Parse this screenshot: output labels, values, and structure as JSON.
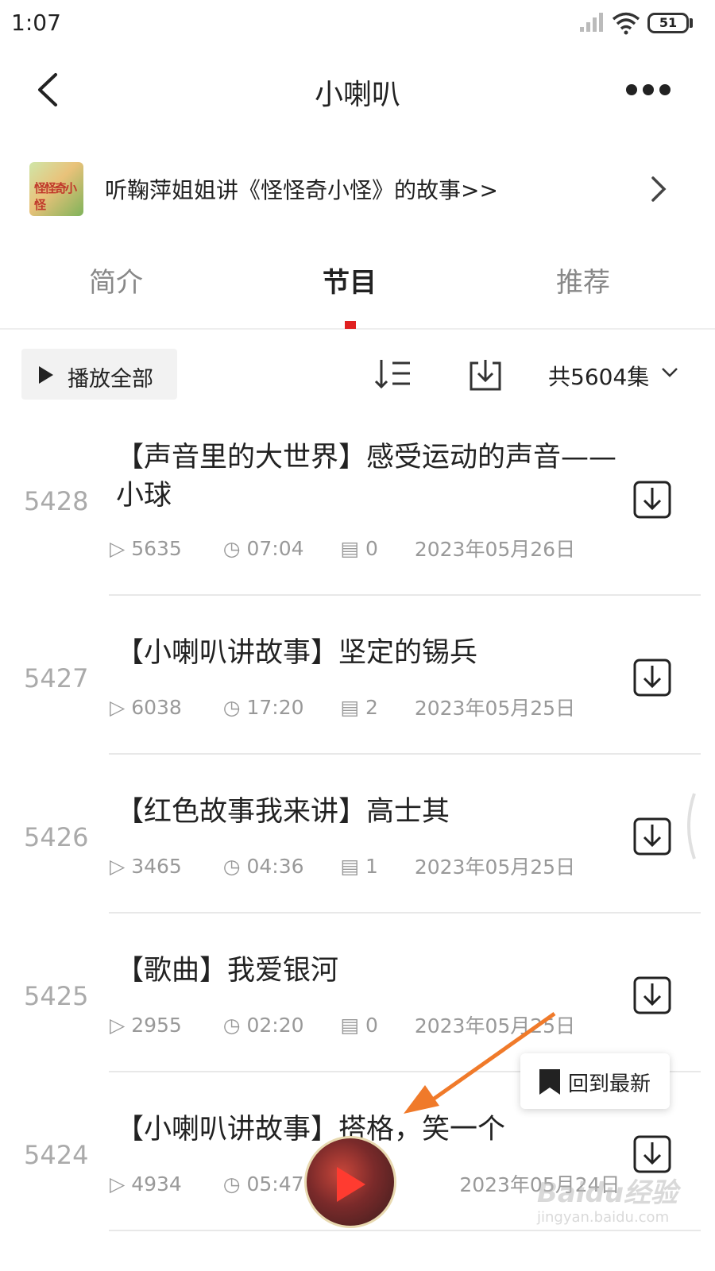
{
  "status_bar": {
    "time": "1:07",
    "battery": "51"
  },
  "header": {
    "title": "小喇叭"
  },
  "banner": {
    "text": "听鞠萍姐姐讲《怪怪奇小怪》的故事>>",
    "cover_text": "怪怪奇小怪"
  },
  "tabs": [
    {
      "label": "简介",
      "active": false
    },
    {
      "label": "节目",
      "active": true
    },
    {
      "label": "推荐",
      "active": false
    }
  ],
  "toolbar": {
    "play_all": "播放全部",
    "count": "共5604集"
  },
  "episodes": [
    {
      "num": "5428",
      "title": "【声音里的大世界】感受运动的声音——小球",
      "plays": "5635",
      "duration": "07:04",
      "comments": "0",
      "date": "2023年05月26日"
    },
    {
      "num": "5427",
      "title": "【小喇叭讲故事】坚定的锡兵",
      "plays": "6038",
      "duration": "17:20",
      "comments": "2",
      "date": "2023年05月25日"
    },
    {
      "num": "5426",
      "title": "【红色故事我来讲】高士其",
      "plays": "3465",
      "duration": "04:36",
      "comments": "1",
      "date": "2023年05月25日"
    },
    {
      "num": "5425",
      "title": "【歌曲】我爱银河",
      "plays": "2955",
      "duration": "02:20",
      "comments": "0",
      "date": "2023年05月25日"
    },
    {
      "num": "5424",
      "title": "【小喇叭讲故事】搭格，笑一个",
      "plays": "4934",
      "duration": "05:47",
      "comments": "",
      "date": "2023年05月24日"
    }
  ],
  "floating": {
    "back_to_latest": "回到最新"
  },
  "watermark": {
    "line1": "Baidu经验",
    "line2": "jingyan.baidu.com"
  },
  "colors": {
    "accent": "#e02020",
    "annotation_arrow": "#f07a2a"
  }
}
